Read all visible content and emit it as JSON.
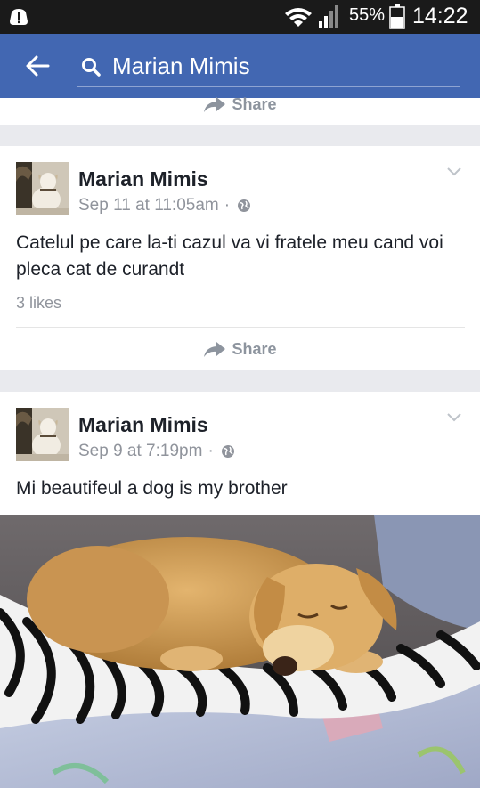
{
  "status_bar": {
    "battery_percent": "55%",
    "time": "14:22",
    "icons": [
      "alert-icon",
      "wifi-icon",
      "signal-icon",
      "battery-icon"
    ]
  },
  "app_bar": {
    "back_icon": "arrow-left-icon",
    "search_query": "Marian Mimis",
    "accent_color": "#4267b2"
  },
  "feed": {
    "top_share_label": "Share",
    "posts": [
      {
        "author": "Marian Mimis",
        "timestamp": "Sep 11 at 11:05am",
        "audience_icon": "globe-icon",
        "text": "Catelul pe care la-ti cazul va vi fratele meu cand voi pleca cat de curandt",
        "likes": "3 likes",
        "share_label": "Share"
      },
      {
        "author": "Marian Mimis",
        "timestamp": "Sep 9 at 7:19pm",
        "audience_icon": "globe-icon",
        "text": "Mi beautifeul a dog is my brother",
        "photo": "sleeping-dog-photo"
      }
    ]
  }
}
